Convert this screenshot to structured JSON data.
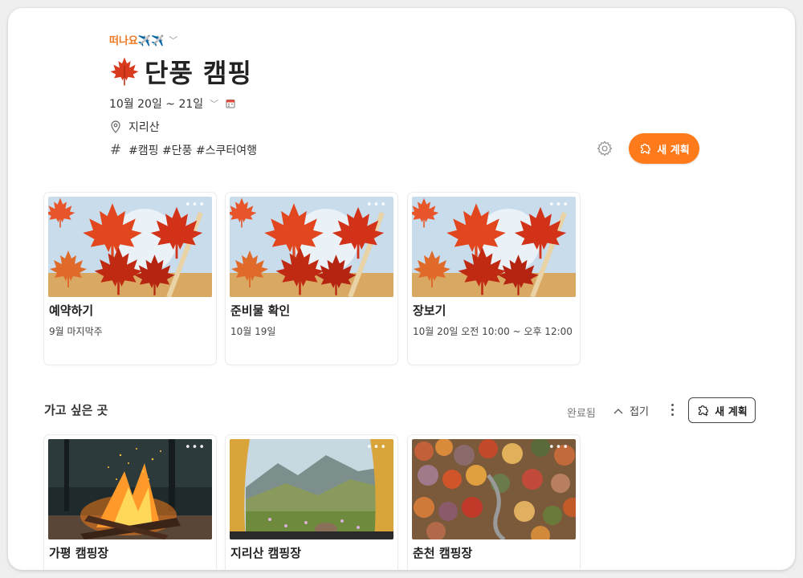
{
  "header": {
    "breadcrumb": "떠나요✈️✈️",
    "breadcrumb_chevron": "chevron-down-icon",
    "title": "단풍 캠핑",
    "title_icon": "maple-leaf-icon",
    "date_range": "10월 20일 ~ 21일",
    "location": "지리산",
    "tags": "#캠핑 #단풍 #스쿠터여행"
  },
  "actions": {
    "new_plan_label": "새 계획"
  },
  "plans": [
    {
      "title": "예약하기",
      "subtitle": "9월 마지막주",
      "image": "maple-leaves"
    },
    {
      "title": "준비물 확인",
      "subtitle": "10월 19일",
      "image": "maple-leaves"
    },
    {
      "title": "장보기",
      "subtitle": "10월 20일 오전 10:00 ~ 오후 12:00",
      "image": "maple-leaves"
    }
  ],
  "wishlist": {
    "title": "가고 싶은 곳",
    "done_label": "완료됨",
    "fold_label": "접기",
    "new_plan_label": "새 계획",
    "items": [
      {
        "title": "가평 캠핑장",
        "image": "campfire"
      },
      {
        "title": "지리산 캠핑장",
        "image": "tent-mountain-view"
      },
      {
        "title": "춘천 캠핑장",
        "image": "autumn-forest-road"
      }
    ]
  },
  "colors": {
    "accent": "#ff7a1a",
    "breadcrumb": "#f07820"
  }
}
